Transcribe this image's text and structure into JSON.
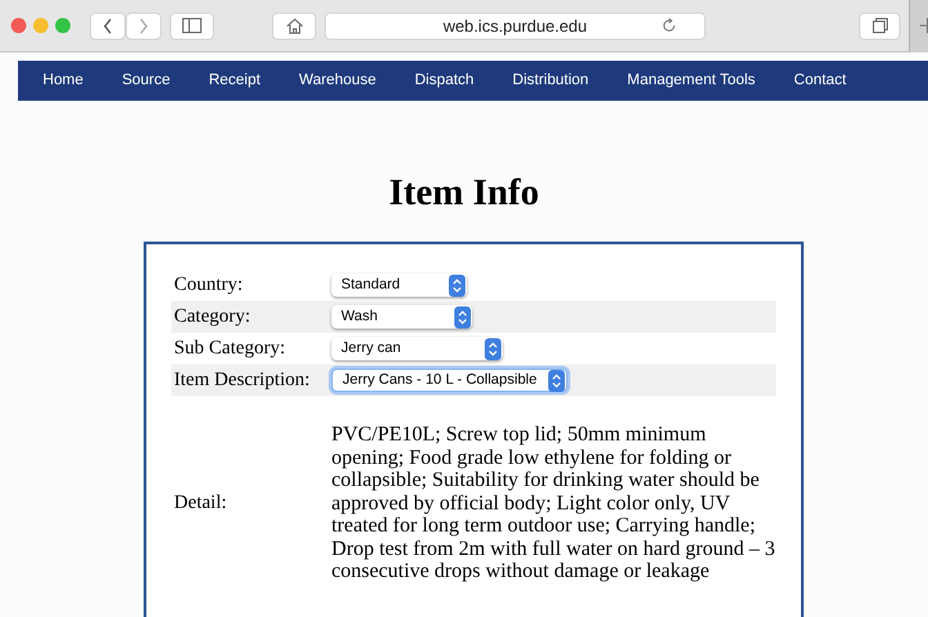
{
  "browser": {
    "url": "web.ics.purdue.edu"
  },
  "nav": [
    "Home",
    "Source",
    "Receipt",
    "Warehouse",
    "Dispatch",
    "Distribution",
    "Management Tools",
    "Contact"
  ],
  "title": "Item Info",
  "fields": [
    {
      "label": "Country:",
      "value": "Standard",
      "focused": false
    },
    {
      "label": "Category:",
      "value": "Wash",
      "focused": false
    },
    {
      "label": "Sub Category:",
      "value": "Jerry can",
      "focused": false
    },
    {
      "label": "Item Description:",
      "value": "Jerry Cans - 10 L - Collapsible",
      "focused": true
    }
  ],
  "detail": {
    "label": "Detail:",
    "text": "PVC/PE10L; Screw top lid; 50mm minimum opening; Food grade low ethylene for folding or collapsible; Suitability for drinking water should be approved by official body; Light color only, UV treated for long term outdoor use; Carrying handle; Drop test from 2m with full water on hard ground – 3 consecutive drops without damage or leakage"
  }
}
